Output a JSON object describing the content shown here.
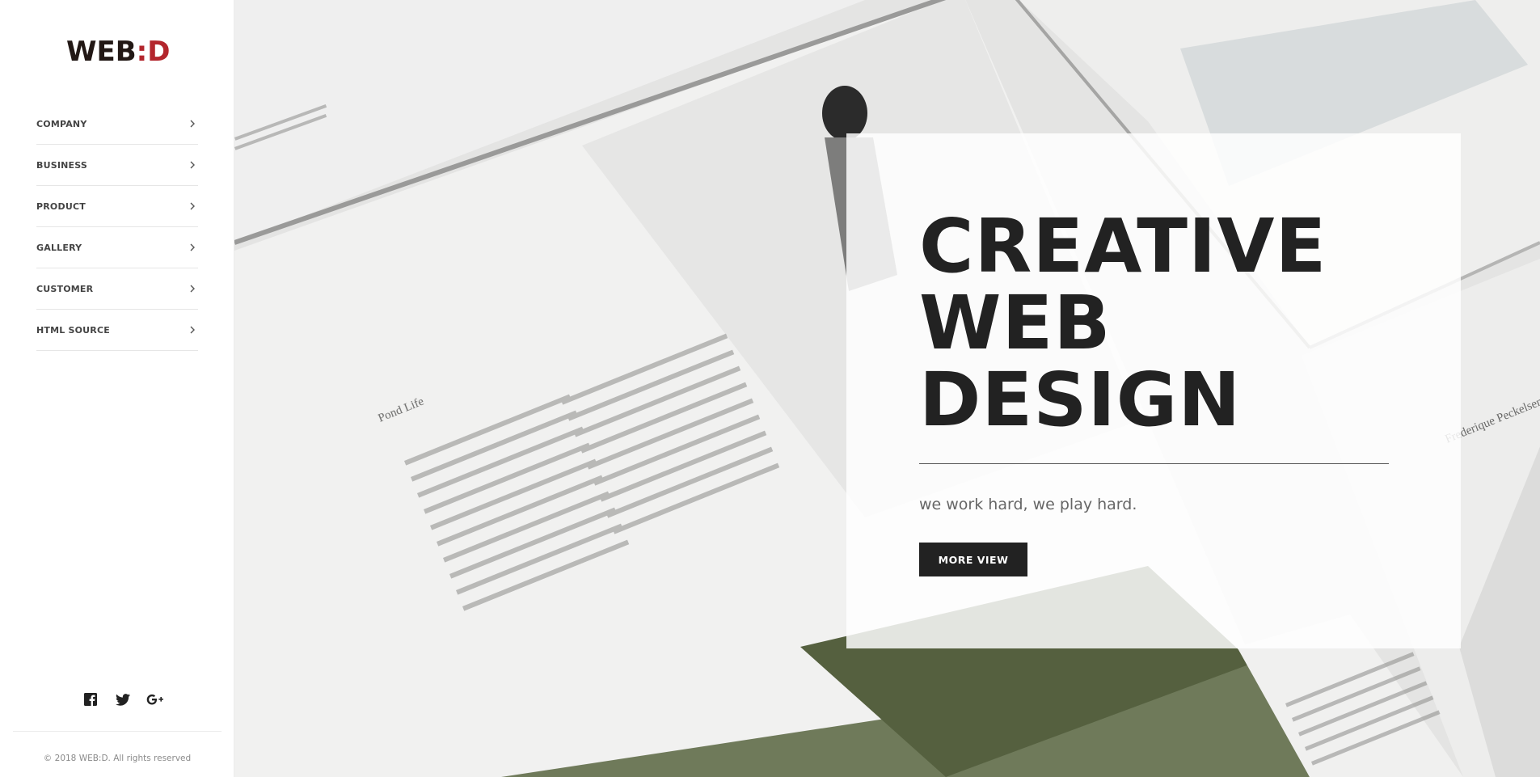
{
  "logo": {
    "text_main": "WEB",
    "text_accent": ":D"
  },
  "nav": {
    "items": [
      {
        "label": "COMPANY"
      },
      {
        "label": "BUSINESS"
      },
      {
        "label": "PRODUCT"
      },
      {
        "label": "GALLERY"
      },
      {
        "label": "CUSTOMER"
      },
      {
        "label": "HTML SOURCE"
      }
    ]
  },
  "social": [
    "facebook-icon",
    "twitter-icon",
    "google-plus-icon"
  ],
  "footer": {
    "copyright": "© 2018 WEB:D. All rights reserved"
  },
  "hero": {
    "headline": [
      "CREATIVE",
      "WEB",
      "DESIGN"
    ],
    "tagline": "we work hard, we play hard.",
    "button_label": "MORE VIEW",
    "background_text": {
      "article_title": "Pond Life",
      "side_title": "Frederique Peckelsen"
    }
  },
  "colors": {
    "brand_dark": "#221815",
    "brand_accent": "#b3262d",
    "button_bg": "#222222"
  }
}
